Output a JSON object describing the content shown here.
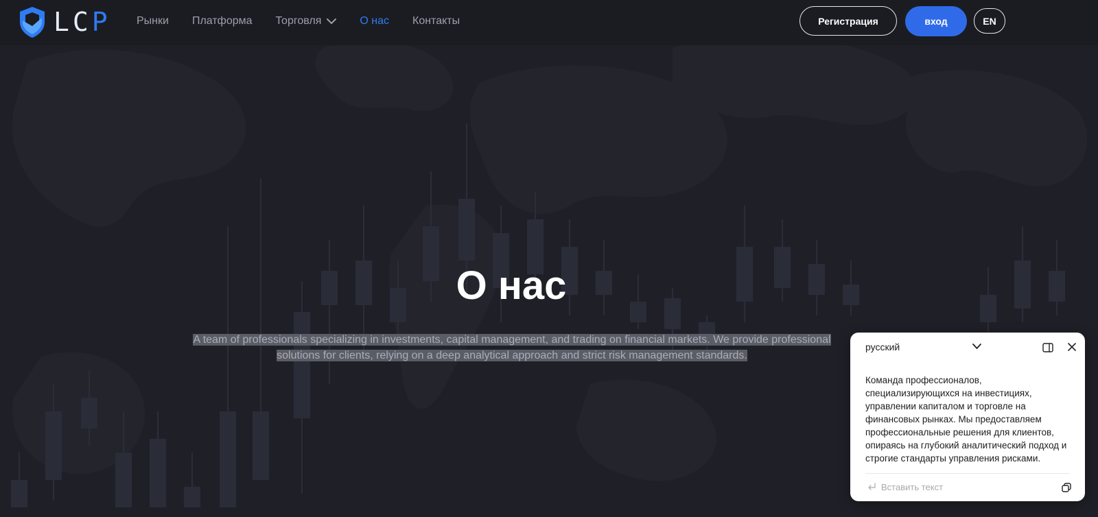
{
  "header": {
    "logo_text": "LCP",
    "nav": [
      {
        "label": "Рынки",
        "active": false
      },
      {
        "label": "Платформа",
        "active": false
      },
      {
        "label": "Торговля",
        "active": false,
        "has_dropdown": true
      },
      {
        "label": "О нас",
        "active": true
      },
      {
        "label": "Контакты",
        "active": false
      }
    ],
    "register_label": "Регистрация",
    "login_label": "вход",
    "lang_label": "EN"
  },
  "hero": {
    "title": "О нас",
    "description": "A team of professionals specializing in investments, capital management, and trading on financial markets. We provide professional solutions for clients, relying on a deep analytical approach and strict risk management standards."
  },
  "translator": {
    "target_language": "русский",
    "translation": "Команда профессионалов, специализирующихся на инвестициях, управлении капиталом и торговле на финансовых рынках. Мы предоставляем профессиональные решения для клиентов, опираясь на глубокий аналитический подход и строгие стандарты управления рисками.",
    "paste_placeholder": "Вставить текст"
  },
  "colors": {
    "background": "#1f2027",
    "header": "#1b1c22",
    "accent": "#2f6be8",
    "active_nav": "#2f7bf2"
  },
  "icons": [
    "shield-logo-icon",
    "chevron-down-icon",
    "panel-icon",
    "close-icon",
    "enter-icon",
    "copy-icon"
  ]
}
